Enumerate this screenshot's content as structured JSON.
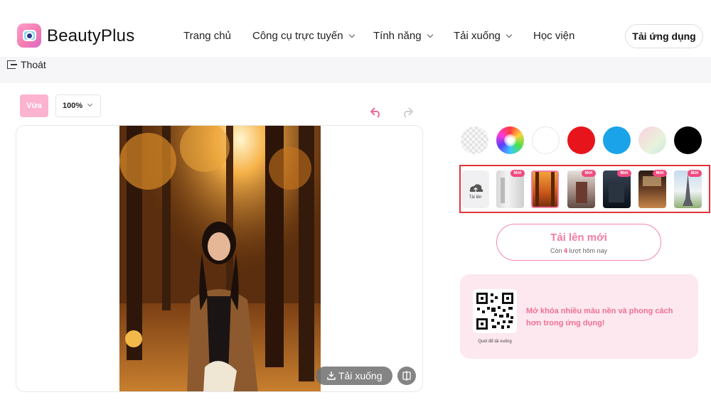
{
  "header": {
    "brand": "BeautyPlus",
    "nav": [
      {
        "label": "Trang chủ",
        "dropdown": false
      },
      {
        "label": "Công cụ trực tuyến",
        "dropdown": true
      },
      {
        "label": "Tính năng",
        "dropdown": true
      },
      {
        "label": "Tải xuống",
        "dropdown": true
      },
      {
        "label": "Học viện",
        "dropdown": false
      }
    ],
    "get_app": "Tải ứng dụng"
  },
  "subbar": {
    "exit_label": "Thoát"
  },
  "toolbar": {
    "fit_label": "Vừa",
    "zoom": "100%"
  },
  "canvas": {
    "download_label": "Tải xuống"
  },
  "colors": {
    "swatches": [
      "transparent",
      "rainbow",
      "#ffffff",
      "#e8141c",
      "#1aa3e8",
      "gradient-pink-mint",
      "#000000"
    ],
    "accent": "#f07ca1"
  },
  "backgrounds": {
    "upload_label": "Tải lên",
    "new_badge": "Mới",
    "items": [
      {
        "name": "white-room",
        "new": false,
        "selected": false
      },
      {
        "name": "autumn-forest",
        "new": false,
        "selected": true
      },
      {
        "name": "pagoda",
        "new": true,
        "selected": false
      },
      {
        "name": "dark-night",
        "new": true,
        "selected": false
      },
      {
        "name": "cafe-interior",
        "new": true,
        "selected": false
      },
      {
        "name": "eiffel-tower",
        "new": true,
        "selected": false
      }
    ]
  },
  "upload": {
    "title": "Tải lên mới",
    "remaining_prefix": "Còn",
    "remaining_count": "4",
    "remaining_suffix": "lượt hôm nay"
  },
  "promo": {
    "qr_caption": "Quét để tải xuống",
    "text": "Mở khóa nhiều màu nền và phong cách hơn trong ứng dụng!"
  }
}
